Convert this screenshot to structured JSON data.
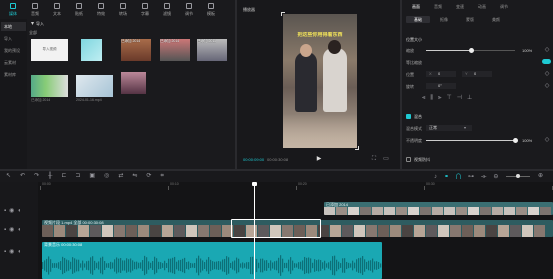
{
  "toolbar": {
    "items": [
      {
        "label": "媒体",
        "icon": "media-icon"
      },
      {
        "label": "音频",
        "icon": "audio-icon"
      },
      {
        "label": "文本",
        "icon": "text-icon"
      },
      {
        "label": "贴纸",
        "icon": "sticker-icon"
      },
      {
        "label": "特效",
        "icon": "effects-icon"
      },
      {
        "label": "转场",
        "icon": "transition-icon"
      },
      {
        "label": "字幕",
        "icon": "subtitle-icon"
      },
      {
        "label": "滤镜",
        "icon": "filter-icon"
      },
      {
        "label": "调节",
        "icon": "adjust-icon"
      },
      {
        "label": "模板",
        "icon": "template-icon"
      }
    ]
  },
  "sidebar": {
    "items": [
      "本地",
      "导入",
      "我的预设",
      "云素材",
      "素材库"
    ]
  },
  "media": {
    "import_label": "导入",
    "section_label": "全部",
    "thumbs": [
      {
        "name": "",
        "caption": "导入视频"
      },
      {
        "name": "",
        "caption": ""
      },
      {
        "name": "已添加 2014",
        "caption": ""
      },
      {
        "name": "已添加 2014",
        "caption": ""
      },
      {
        "name": "已添加 2011",
        "caption": ""
      },
      {
        "name": "已添加 2014",
        "caption": ""
      },
      {
        "name": "2024-01-16.mp4",
        "caption": ""
      },
      {
        "name": "",
        "caption": ""
      },
      {
        "name": "已添加 2014",
        "caption": ""
      }
    ]
  },
  "player": {
    "title": "播放器",
    "subtitle_overlay": "把这些你用得着东西",
    "time_current": "00:00:09:00",
    "time_total": "00:00:30:08"
  },
  "properties": {
    "tabs": [
      "画面",
      "音频",
      "变速",
      "动画",
      "调节"
    ],
    "subtabs": [
      "基础",
      "抠像",
      "蒙版",
      "美颜"
    ],
    "position_label": "位置大小",
    "scale_label": "缩放",
    "scale_value": "100%",
    "uniform_label": "等比缩放",
    "pos_label": "位置",
    "x_value": "0",
    "y_value": "0",
    "rotate_label": "旋转",
    "rotate_value": "0°",
    "blend_label": "混合",
    "blend_mode_label": "混合模式",
    "blend_mode_value": "正常",
    "opacity_label": "不透明度",
    "opacity_value": "100%",
    "stabilize_label": "视频防抖",
    "scale_fill": 0.5,
    "opacity_fill": 1.0
  },
  "timeline": {
    "ruler": [
      "00:00",
      "00:10",
      "00:20",
      "00:30",
      "00:40"
    ],
    "clip_label_top": "已添加 2014",
    "clip_label_main": "视频片段 1.mp4  全部 00:00:30:08",
    "audio_label": "背景音乐  00:00:30:08",
    "playhead_fraction": 0.46
  },
  "colors": {
    "accent": "#1ecad3",
    "track": "#3a6e72",
    "audio": "#1aa8b3"
  }
}
